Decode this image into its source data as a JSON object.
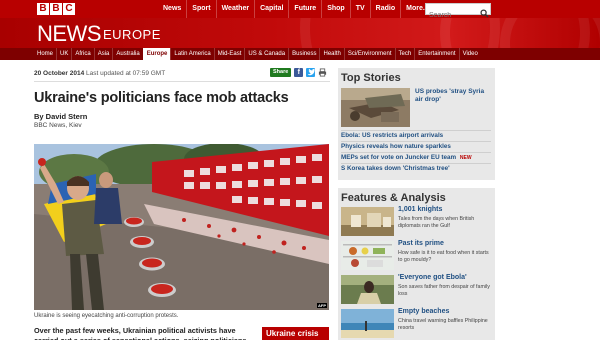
{
  "header": {
    "logo_letters": [
      "B",
      "B",
      "C"
    ],
    "nav_items": [
      "News",
      "Sport",
      "Weather",
      "Capital",
      "Future",
      "Shop",
      "TV",
      "Radio",
      "More..."
    ],
    "search_placeholder": "Search",
    "brand_color": "#b80000"
  },
  "banner": {
    "title": "NEWS",
    "edition": "EUROPE"
  },
  "section_nav": {
    "items": [
      "Home",
      "UK",
      "Africa",
      "Asia",
      "Australia",
      "Europe",
      "Latin America",
      "Mid-East",
      "US & Canada",
      "Business",
      "Health",
      "Sci/Environment",
      "Tech",
      "Entertainment",
      "Video"
    ],
    "active": "Europe"
  },
  "article": {
    "date": "20 October 2014",
    "updated": "Last updated at 07:59 GMT",
    "share_label": "Share",
    "headline": "Ukraine's politicians face mob attacks",
    "byline": "By David Stern",
    "byline_org": "BBC News, Kiev",
    "photo_credit": "AFP",
    "caption": "Ukraine is seeing eyecatching anti-corruption protests.",
    "body": "Over the past few weeks, Ukrainian political activists have carried out a series of sensational actions, seizing politicians and local",
    "sidebar_box": "Ukraine crisis"
  },
  "top_stories": {
    "heading": "Top Stories",
    "lead": "US probes 'stray Syria air drop'",
    "items": [
      {
        "text": "Ebola: US restricts airport arrivals",
        "new": ""
      },
      {
        "text": "Physics reveals how nature sparkles",
        "new": ""
      },
      {
        "text": "MEPs set for vote on Juncker EU team",
        "new": "NEW"
      },
      {
        "text": "S Korea takes down 'Christmas tree'",
        "new": ""
      }
    ]
  },
  "features": {
    "heading": "Features & Analysis",
    "items": [
      {
        "title": "1,001 knights",
        "desc": "Tales from the days when British diplomats ran the Gulf"
      },
      {
        "title": "Past its prime",
        "desc": "How safe is it to eat food when it starts to go mouldy?"
      },
      {
        "title": "'Everyone got Ebola'",
        "desc": "Son saves father from despair of family loss"
      },
      {
        "title": "Empty beaches",
        "desc": "China travel warning baffles Philippine resorts"
      }
    ]
  }
}
